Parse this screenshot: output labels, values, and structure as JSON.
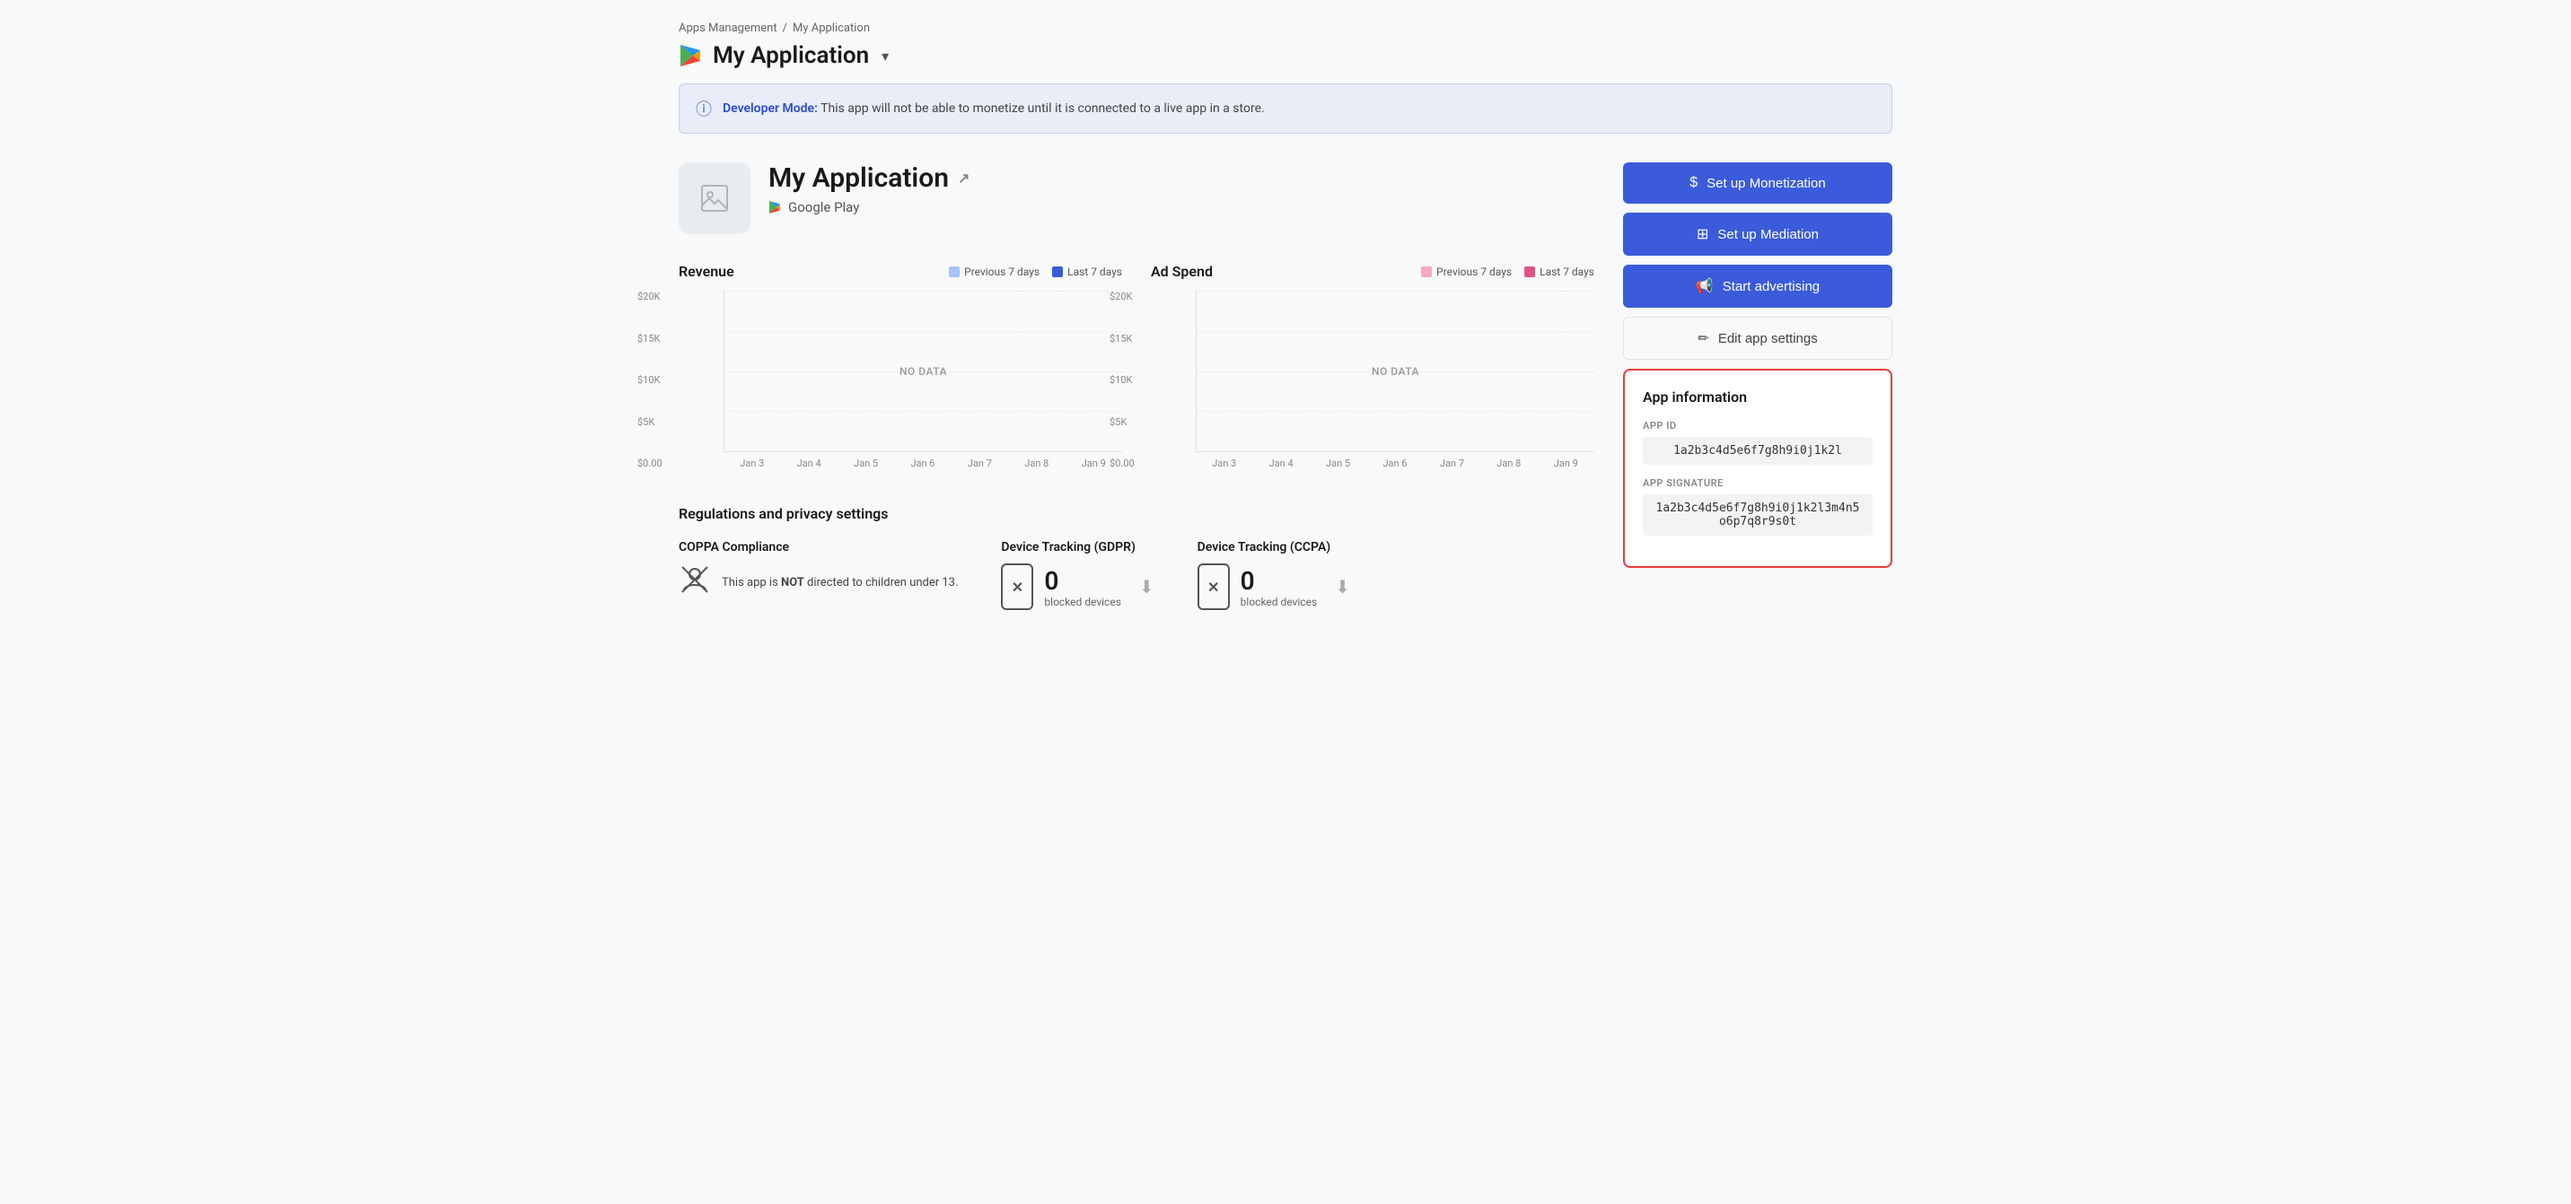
{
  "breadcrumb": {
    "parent": "Apps Management",
    "separator": "/",
    "current": "My Application"
  },
  "header": {
    "app_name": "My Application",
    "dropdown_arrow": "▾"
  },
  "banner": {
    "label": "Developer Mode:",
    "message": "This app will not be able to monetize until it is connected to a live app in a store."
  },
  "app": {
    "name": "My Application",
    "platform": "Google Play"
  },
  "revenue_chart": {
    "title": "Revenue",
    "legend_prev": "Previous 7 days",
    "legend_last": "Last 7 days",
    "prev_color": "#a8c4f5",
    "last_color": "#3b5bdb",
    "no_data": "NO DATA",
    "y_labels": [
      "$20K",
      "$15K",
      "$10K",
      "$5K",
      "$0.00"
    ],
    "x_labels": [
      "Jan 3",
      "Jan 4",
      "Jan 5",
      "Jan 6",
      "Jan 7",
      "Jan 8",
      "Jan 9"
    ]
  },
  "adspend_chart": {
    "title": "Ad Spend",
    "legend_prev": "Previous 7 days",
    "legend_last": "Last 7 days",
    "prev_color": "#f5a8c4",
    "last_color": "#e05580",
    "no_data": "NO DATA",
    "y_labels": [
      "$20K",
      "$15K",
      "$10K",
      "$5K",
      "$0.00"
    ],
    "x_labels": [
      "Jan 3",
      "Jan 4",
      "Jan 5",
      "Jan 6",
      "Jan 7",
      "Jan 8",
      "Jan 9"
    ]
  },
  "regulations": {
    "section_title": "Regulations and privacy settings",
    "coppa": {
      "label": "COPPA Compliance",
      "text_part1": "This app is ",
      "text_bold": "NOT",
      "text_part2": " directed to children under 13."
    },
    "gdpr": {
      "label": "Device Tracking (GDPR)",
      "count": "0",
      "unit": "blocked devices"
    },
    "ccpa": {
      "label": "Device Tracking (CCPA)",
      "count": "0",
      "unit": "blocked devices"
    }
  },
  "sidebar": {
    "btn_monetization": "Set up Monetization",
    "btn_mediation": "Set up Mediation",
    "btn_advertising": "Start advertising",
    "btn_edit": "Edit app settings",
    "app_info_title": "App information",
    "app_id_label": "APP ID",
    "app_id_value": "1a2b3c4d5e6f7g8h9i0j1k2l",
    "app_sig_label": "APP SIGNATURE",
    "app_sig_value": "1a2b3c4d5e6f7g8h9i0j1k2l3m4n5o6p7q8r9s0t"
  }
}
